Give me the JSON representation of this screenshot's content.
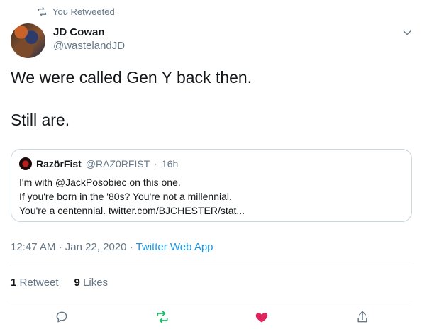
{
  "retweet_context": {
    "label": "You Retweeted"
  },
  "author": {
    "name": "JD Cowan",
    "handle": "@wastelandJD"
  },
  "tweet": {
    "line1": "We were called Gen Y back then.",
    "line2": "Still are."
  },
  "quoted_tweet": {
    "name": "RazörFist",
    "handle": "@RAZ0RFIST",
    "separator": "·",
    "time": "16h",
    "lines": [
      "I'm with @JackPosobiec on this one.",
      "If you're born in the '80s? You're not a millennial.",
      "You're a centennial. twitter.com/BJCHESTER/stat..."
    ]
  },
  "meta": {
    "time": "12:47 AM",
    "separator": "·",
    "date": "Jan 22, 2020",
    "source": "Twitter Web App"
  },
  "stats": {
    "retweets_count": "1",
    "retweets_label": "Retweet",
    "likes_count": "9",
    "likes_label": "Likes"
  },
  "icons": {
    "retweet_context": "retweet-icon",
    "more": "chevron-down-icon",
    "reply": "reply-icon",
    "retweet": "retweet-icon",
    "like": "heart-icon",
    "share": "share-icon"
  },
  "colors": {
    "text": "#14171a",
    "secondary": "#657786",
    "link": "#1b95e0",
    "retweet_active": "#17bf63",
    "like_active": "#e0245e",
    "border": "#ccd6dd"
  }
}
